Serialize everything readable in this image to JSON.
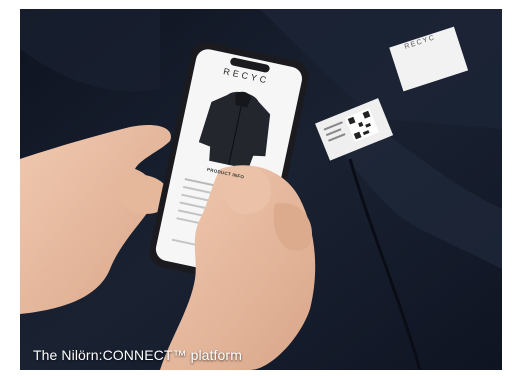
{
  "caption": "The Nilörn:CONNECT™ platform",
  "phone_screen": {
    "brand": "RECYC",
    "section_title": "PRODUCT INFO"
  },
  "label_tag": {
    "brand": "RECYC"
  },
  "colors": {
    "jacket": "#161c2b",
    "skin": "#e8bfa5",
    "phone_body": "#1b1b1f",
    "screen_bg": "#f6f6f6",
    "caption_text": "#ffffff"
  }
}
